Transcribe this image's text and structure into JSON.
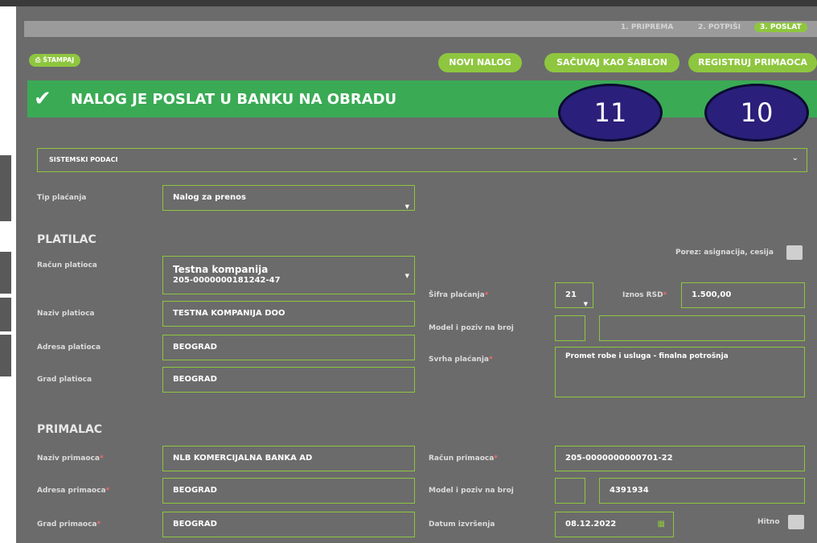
{
  "steps": [
    "1. PRIPREMA",
    "2. POTPIŠI",
    "3. POSLAT"
  ],
  "toolbar": {
    "print_label": "ŠTAMPAJ",
    "new_order": "NOVI NALOG",
    "save_template": "SAČUVAJ KAO ŠABLON",
    "register_recipient": "REGISTRUJ PRIMAOCA"
  },
  "banner": {
    "text": "NALOG JE POSLAT U BANKU NA OBRADU"
  },
  "callouts": {
    "a": "11",
    "b": "10"
  },
  "system": {
    "label": "SISTEMSKI PODACI"
  },
  "payment_type": {
    "label": "Tip plaćanja",
    "value": "Nalog za prenos"
  },
  "payer": {
    "heading": "PLATILAC",
    "account_label": "Račun platioca",
    "account_name": "Testna kompanija",
    "account_number": "205-0000000181242-47",
    "name_label": "Naziv platioca",
    "name_value": "TESTNA KOMPANIJA DOO",
    "address_label": "Adresa platioca",
    "address_value": "BEOGRAD",
    "city_label": "Grad platioca",
    "city_value": "BEOGRAD"
  },
  "tax": {
    "label": "Porez: asignacija, cesija"
  },
  "payment": {
    "code_label": "Šifra plaćanja",
    "code_value": "21",
    "amount_label": "Iznos RSD",
    "amount_value": "1.500,00",
    "model_label": "Model i poziv na broj",
    "model_value": "",
    "reference_value": "",
    "purpose_label": "Svrha plaćanja",
    "purpose_value": "Promet robe i usluga - finalna potrošnja"
  },
  "recipient": {
    "heading": "PRIMALAC",
    "name_label": "Naziv primaoca",
    "name_value": "NLB KOMERCIJALNA BANKA AD",
    "address_label": "Adresa primaoca",
    "address_value": "BEOGRAD",
    "city_label": "Grad primaoca",
    "city_value": "BEOGRAD",
    "account_label": "Račun primaoca",
    "account_value": "205-0000000000701-22",
    "model_label": "Model i poziv na broj",
    "model_value": "",
    "reference_value": "4391934",
    "date_label": "Datum izvršenja",
    "date_value": "08.12.2022",
    "urgent_label": "Hitno"
  },
  "required_mark": "*",
  "colors": {
    "accent": "#8ec63f",
    "banner": "#3aaa55",
    "callout": "#2a1f7a",
    "panel": "#6b6b6b"
  }
}
